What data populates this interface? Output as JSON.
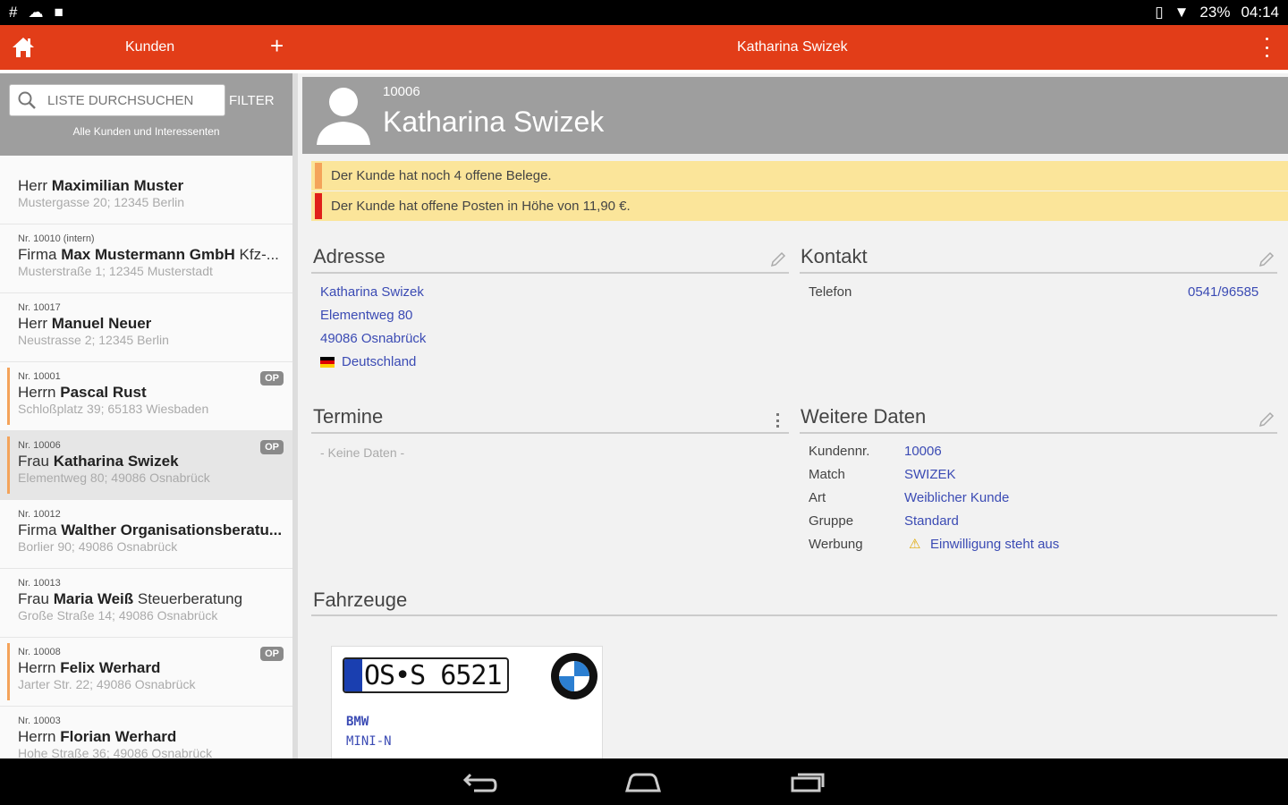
{
  "statusbar": {
    "battery": "23%",
    "time": "04:14"
  },
  "appbar": {
    "left_title": "Kunden",
    "center_title": "Katharina Swizek"
  },
  "sidebar": {
    "search_placeholder": "LISTE DURCHSUCHEN",
    "filter_label": "FILTER",
    "subtitle": "Alle Kunden und Interessenten",
    "customers": [
      {
        "nr": "",
        "salutation": "Herr",
        "name": "Maximilian Muster",
        "suffix": "",
        "address": "Mustergasse 20; 12345 Berlin",
        "op": "",
        "selected": false
      },
      {
        "nr": "Nr. 10010 (intern)",
        "salutation": "Firma",
        "name": "Max Mustermann GmbH",
        "suffix": "Kfz-...",
        "address": "Musterstraße 1; 12345 Musterstadt",
        "op": "",
        "selected": false
      },
      {
        "nr": "Nr. 10017",
        "salutation": "Herr",
        "name": "Manuel Neuer",
        "suffix": "",
        "address": "Neustrasse 2; 12345 Berlin",
        "op": "",
        "selected": false
      },
      {
        "nr": "Nr. 10001",
        "salutation": "Herrn",
        "name": "Pascal Rust",
        "suffix": "",
        "address": "Schloßplatz 39; 65183 Wiesbaden",
        "op": "OP",
        "selected": false
      },
      {
        "nr": "Nr. 10006",
        "salutation": "Frau",
        "name": "Katharina Swizek",
        "suffix": "",
        "address": "Elementweg 80; 49086 Osnabrück",
        "op": "OP",
        "selected": true
      },
      {
        "nr": "Nr. 10012",
        "salutation": "Firma",
        "name": "Walther Organisationsberatu...",
        "suffix": "",
        "address": "Borlier 90; 49086 Osnabrück",
        "op": "",
        "selected": false
      },
      {
        "nr": "Nr. 10013",
        "salutation": "Frau",
        "name": "Maria Weiß",
        "suffix": "Steuerberatung",
        "address": "Große Straße 14; 49086 Osnabrück",
        "op": "",
        "selected": false
      },
      {
        "nr": "Nr. 10008",
        "salutation": "Herrn",
        "name": "Felix Werhard",
        "suffix": "",
        "address": "Jarter Str. 22; 49086 Osnabrück",
        "op": "OP",
        "selected": false
      },
      {
        "nr": "Nr. 10003",
        "salutation": "Herrn",
        "name": "Florian Werhard",
        "suffix": "",
        "address": "Hohe Straße 36; 49086 Osnabrück",
        "op": "",
        "selected": false
      }
    ]
  },
  "detail": {
    "nr": "10006",
    "name": "Katharina Swizek",
    "alerts": [
      {
        "text": "Der Kunde hat noch 4 offene Belege.",
        "color": "#f4a35a"
      },
      {
        "text": "Der Kunde hat offene Posten in Höhe von 11,90 €.",
        "color": "#e0201a"
      }
    ],
    "address": {
      "title": "Adresse",
      "line1": "Katharina Swizek",
      "line2": "Elementweg 80",
      "line3": "49086 Osnabrück",
      "country": "Deutschland"
    },
    "contact": {
      "title": "Kontakt",
      "label": "Telefon",
      "value": "0541/96585"
    },
    "appointments": {
      "title": "Termine",
      "empty": "- Keine Daten -"
    },
    "more": {
      "title": "Weitere Daten",
      "rows": [
        {
          "label": "Kundennr.",
          "value": "10006"
        },
        {
          "label": "Match",
          "value": "SWIZEK"
        },
        {
          "label": "Art",
          "value": "Weiblicher Kunde"
        },
        {
          "label": "Gruppe",
          "value": "Standard"
        },
        {
          "label": "Werbung",
          "value": "Einwilligung steht aus"
        }
      ]
    },
    "vehicles": {
      "title": "Fahrzeuge",
      "plate": "OS•S 6521",
      "brand": "BMW",
      "model": "MINI-N"
    }
  }
}
